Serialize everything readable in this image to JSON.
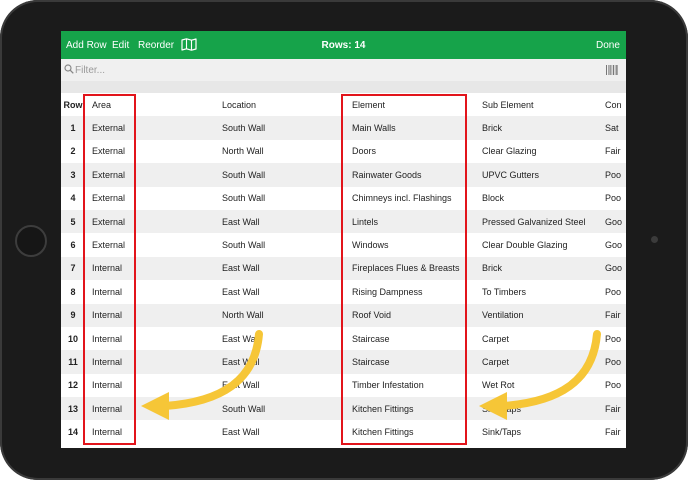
{
  "toolbar": {
    "add_row": "Add Row",
    "edit": "Edit",
    "reorder": "Reorder",
    "map_icon": "map-icon",
    "title": "Rows: 14",
    "done": "Done",
    "bg_color": "#16a34a"
  },
  "filter": {
    "placeholder": "Filter...",
    "search_icon": "search-icon",
    "barcode_icon": "barcode-icon"
  },
  "table": {
    "headers": [
      "Row",
      "Area",
      "Location",
      "Element",
      "Sub Element",
      "Con"
    ],
    "rows": [
      {
        "num": "1",
        "area": "External",
        "location": "South Wall",
        "element": "Main Walls",
        "sub": "Brick",
        "cond": "Sat"
      },
      {
        "num": "2",
        "area": "External",
        "location": "North Wall",
        "element": "Doors",
        "sub": "Clear Glazing",
        "cond": "Fair"
      },
      {
        "num": "3",
        "area": "External",
        "location": "South Wall",
        "element": "Rainwater Goods",
        "sub": "UPVC Gutters",
        "cond": "Poo"
      },
      {
        "num": "4",
        "area": "External",
        "location": "South Wall",
        "element": "Chimneys incl. Flashings",
        "sub": "Block",
        "cond": "Poo"
      },
      {
        "num": "5",
        "area": "External",
        "location": "East Wall",
        "element": "Lintels",
        "sub": "Pressed Galvanized Steel",
        "cond": "Goo"
      },
      {
        "num": "6",
        "area": "External",
        "location": "South Wall",
        "element": "Windows",
        "sub": "Clear Double Glazing",
        "cond": "Goo"
      },
      {
        "num": "7",
        "area": "Internal",
        "location": "East Wall",
        "element": "Fireplaces Flues & Breasts",
        "sub": "Brick",
        "cond": "Goo"
      },
      {
        "num": "8",
        "area": "Internal",
        "location": "East Wall",
        "element": "Rising Dampness",
        "sub": "To Timbers",
        "cond": "Poo"
      },
      {
        "num": "9",
        "area": "Internal",
        "location": "North Wall",
        "element": "Roof Void",
        "sub": "Ventilation",
        "cond": "Fair"
      },
      {
        "num": "10",
        "area": "Internal",
        "location": "East Wall",
        "element": "Staircase",
        "sub": "Carpet",
        "cond": "Poo"
      },
      {
        "num": "11",
        "area": "Internal",
        "location": "East Wall",
        "element": "Staircase",
        "sub": "Carpet",
        "cond": "Poo"
      },
      {
        "num": "12",
        "area": "Internal",
        "location": "East Wall",
        "element": "Timber Infestation",
        "sub": "Wet Rot",
        "cond": "Poo"
      },
      {
        "num": "13",
        "area": "Internal",
        "location": "South Wall",
        "element": "Kitchen Fittings",
        "sub": "Sink/Taps",
        "cond": "Fair"
      },
      {
        "num": "14",
        "area": "Internal",
        "location": "East Wall",
        "element": "Kitchen Fittings",
        "sub": "Sink/Taps",
        "cond": "Fair"
      }
    ]
  },
  "annotations": {
    "highlight_color": "#e2141b",
    "arrow_color": "#f6c637"
  }
}
